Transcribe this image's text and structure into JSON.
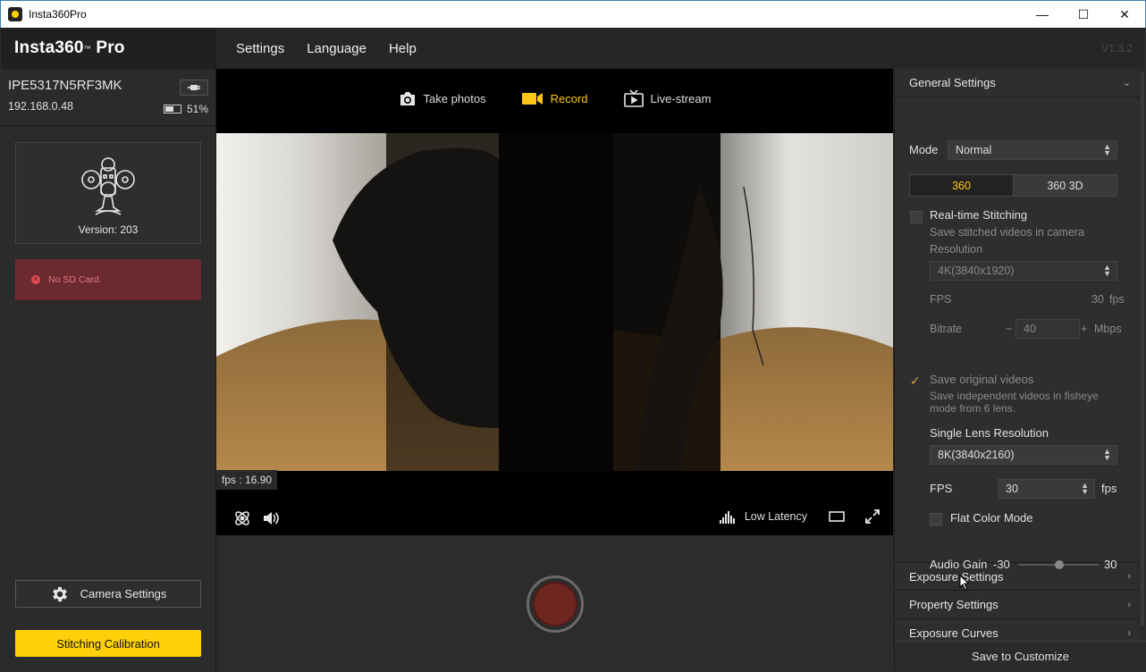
{
  "window": {
    "title": "Insta360Pro",
    "minimize": "—",
    "maximize": "☐",
    "close": "✕"
  },
  "brand": {
    "name": "Insta360",
    "sup": "™",
    "suffix": " Pro"
  },
  "menu": {
    "items": [
      "Settings",
      "Language",
      "Help"
    ],
    "version": "V1.3.2"
  },
  "device": {
    "serial": "IPE5317N5RF3MK",
    "ip": "192.168.0.48",
    "battery": "51%",
    "battery_level": 0.51
  },
  "camera": {
    "version_label": "Version:",
    "version": "203"
  },
  "alert": {
    "text": "No SD Card."
  },
  "sidebar": {
    "camera_settings": "Camera Settings",
    "stitching_calibration": "Stitching Calibration"
  },
  "modes": {
    "photo": "Take photos",
    "record": "Record",
    "live": "Live-stream",
    "active": "Record"
  },
  "preview": {
    "fps": "fps : 16.90",
    "latency": "Low Latency"
  },
  "panel": {
    "general": "General Settings",
    "mode_label": "Mode",
    "mode_value": "Normal",
    "seg_360": "360",
    "seg_3d": "360 3D",
    "rts_label": "Real-time Stitching",
    "rts_desc": "Save stitched videos in camera",
    "resolution_label": "Resolution",
    "resolution_value": "4K(3840x1920)",
    "fps_label": "FPS",
    "fps_value": "30",
    "fps_unit": "fps",
    "bitrate_label": "Bitrate",
    "bitrate_minus": "−",
    "bitrate_value": "40",
    "bitrate_plus": "+",
    "bitrate_unit": "Mbps",
    "save_orig_label": "Save original videos",
    "save_orig_desc1": "Save independent videos in fisheye",
    "save_orig_desc2": "mode from 6 lens.",
    "slr_label": "Single Lens Resolution",
    "slr_value": "8K(3840x2160)",
    "fps2_label": "FPS",
    "fps2_value": "30",
    "fps2_unit": "fps",
    "flat_label": "Flat Color Mode",
    "audio_label": "Audio Gain",
    "audio_min": "-30",
    "audio_max": "30",
    "exposure": "Exposure Settings",
    "property": "Property Settings",
    "curves": "Exposure Curves",
    "save_customize": "Save to Customize"
  },
  "colors": {
    "accent": "#ffc61a",
    "stitch_button": "#ffd10a",
    "alert_bg": "#6b2a2f",
    "record": "#6e2621"
  }
}
